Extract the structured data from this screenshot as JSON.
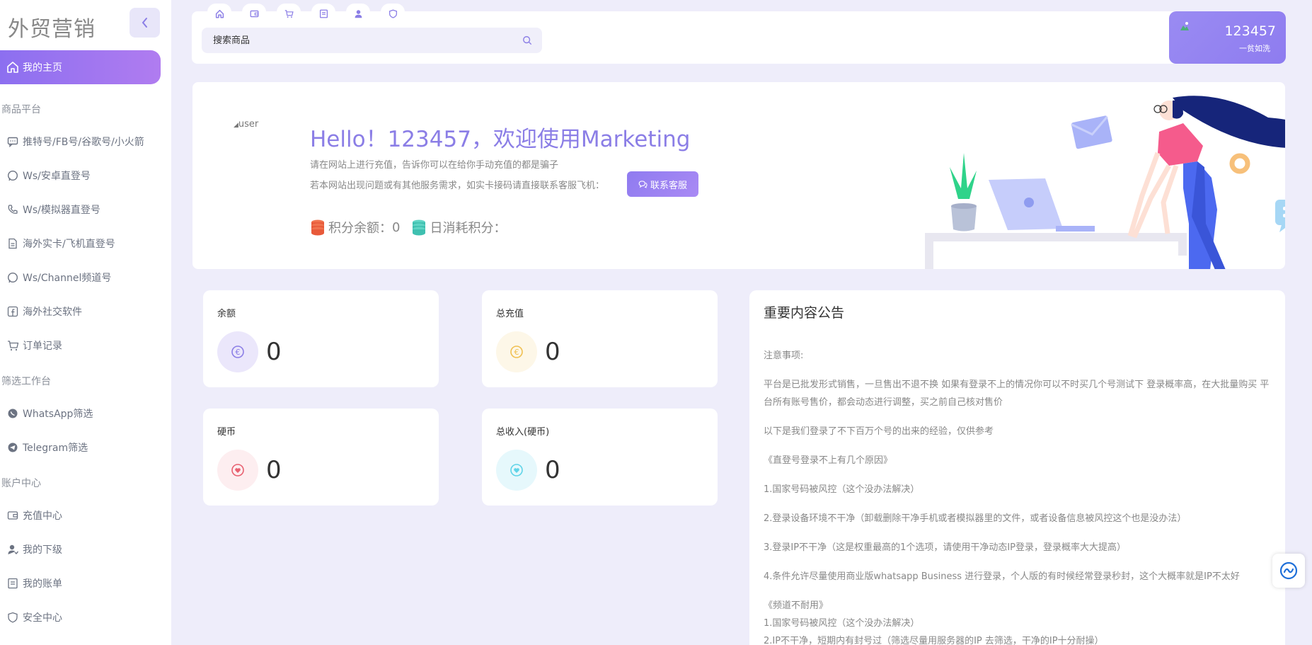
{
  "sidebar": {
    "brand": "外贸营销",
    "home": "我的主页",
    "section_goods": "商品平台",
    "goods": [
      "推特号/FB号/谷歌号/小火箭",
      "Ws/安卓直登号",
      "Ws/模拟器直登号",
      "海外实卡/飞机直登号",
      "Ws/Channel频道号",
      "海外社交软件",
      "订单记录"
    ],
    "section_filter": "筛选工作台",
    "filter": [
      "WhatsApp筛选",
      "Telegram筛选"
    ],
    "section_account": "账户中心",
    "account": [
      "充值中心",
      "我的下级",
      "我的账单",
      "安全中心"
    ]
  },
  "header": {
    "search_placeholder": "搜索商品",
    "username": "123457",
    "user_tier": "一贫如洗"
  },
  "welcome": {
    "avatar_alt": "user",
    "greeting": "Hello！123457，欢迎使用Marketing",
    "line1": "请在网站上进行充值，告诉你可以在给你手动充值的都是骗子",
    "line2": "若本网站出现问题或有其他服务需求，如实卡接码请直接联系客服飞机：",
    "contact_button": "联系客服",
    "points_label": "积分余额：",
    "points_value": "0",
    "daily_label": "日消耗积分："
  },
  "stats": [
    {
      "title": "余额",
      "value": "0",
      "color": "#8b7ee6",
      "bg": "#ebe7fb"
    },
    {
      "title": "总充值",
      "value": "0",
      "color": "#f0c050",
      "bg": "#fdf7e8"
    },
    {
      "title": "硬币",
      "value": "0",
      "color": "#e86070",
      "bg": "#fdeef0"
    },
    {
      "title": "总收入(硬币)",
      "value": "0",
      "color": "#5fd4e8",
      "bg": "#e6f8fc"
    }
  ],
  "notice": {
    "title": "重要内容公告",
    "paragraphs": [
      "注意事项:",
      "平台是已批发形式销售，一旦售出不退不换 如果有登录不上的情况你可以不时买几个号测试下 登录概率高，在大批量购买 平台所有账号售价，都会动态进行调整，买之前自己核对售价",
      "以下是我们登录了不下百万个号的出来的经验，仅供参考",
      "《直登号登录不上有几个原因》",
      "1.国家号码被风控（这个没办法解决）",
      "2.登录设备环境不干净（卸载删除干净手机或者模拟器里的文件，或者设备信息被风控这个也是没办法）",
      "3.登录IP不干净（这是权重最高的1个选项，请使用干净动态IP登录，登录概率大大提高）",
      "4.条件允许尽量使用商业版whatsapp Business 进行登录，个人版的有时候经常登录秒封，这个大概率就是IP不太好",
      "《频道不耐用》",
      "1.国家号码被风控（这个没办法解决）",
      "2.IP不干净，短期内有封号过（筛选尽量用服务器的IP 去筛选，干净的IP十分耐操）"
    ]
  }
}
